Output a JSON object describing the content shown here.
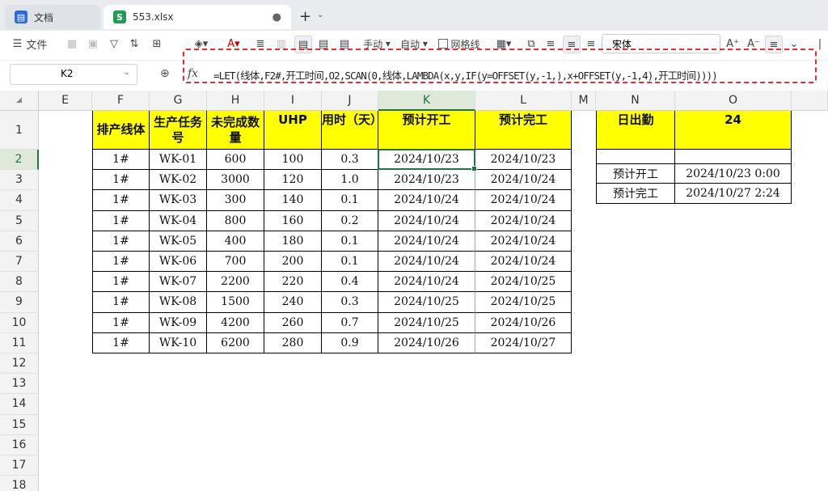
{
  "tabs": [
    {
      "label": "文档",
      "active": false,
      "icon": "doc-icon",
      "color": "#2f6bd8"
    },
    {
      "label": "553.xlsx",
      "active": true,
      "icon": "sheet-icon",
      "color": "#1f9d55"
    }
  ],
  "toolbar": {
    "file_label": "文件",
    "manual_label": "手动",
    "auto_label": "自动",
    "gridlines_label": "网格线",
    "font_name": "宋体"
  },
  "formula_bar": {
    "cell_ref": "K2",
    "formula": "=LET(线体,F2#,开工时间,O2,SCAN(0,线体,LAMBDA(x,y,IF(y=OFFSET(y,-1,),x+OFFSET(y,-1,4),开工时间))))"
  },
  "columns": [
    "E",
    "F",
    "G",
    "H",
    "I",
    "J",
    "K",
    "L",
    "M",
    "N",
    "O"
  ],
  "selected_column": "K",
  "rows": [
    "1",
    "2",
    "3",
    "4",
    "5",
    "6",
    "7",
    "8",
    "9",
    "10",
    "11",
    "12",
    "13",
    "14",
    "15",
    "16",
    "17",
    "18"
  ],
  "selected_row": "2",
  "table": {
    "headers": [
      "排产线体",
      "生产任务号",
      "未完成数量",
      "UHP",
      "用时（天）",
      "预计开工",
      "预计完工"
    ],
    "data": [
      [
        "1#",
        "WK-01",
        "600",
        "100",
        "0.3",
        "2024/10/23",
        "2024/10/23"
      ],
      [
        "1#",
        "WK-02",
        "3000",
        "120",
        "1.0",
        "2024/10/23",
        "2024/10/24"
      ],
      [
        "1#",
        "WK-03",
        "300",
        "140",
        "0.1",
        "2024/10/24",
        "2024/10/24"
      ],
      [
        "1#",
        "WK-04",
        "800",
        "160",
        "0.2",
        "2024/10/24",
        "2024/10/24"
      ],
      [
        "1#",
        "WK-05",
        "400",
        "180",
        "0.1",
        "2024/10/24",
        "2024/10/24"
      ],
      [
        "1#",
        "WK-06",
        "700",
        "200",
        "0.1",
        "2024/10/24",
        "2024/10/24"
      ],
      [
        "1#",
        "WK-07",
        "2200",
        "220",
        "0.4",
        "2024/10/24",
        "2024/10/25"
      ],
      [
        "1#",
        "WK-08",
        "1500",
        "240",
        "0.3",
        "2024/10/25",
        "2024/10/25"
      ],
      [
        "1#",
        "WK-09",
        "4200",
        "260",
        "0.7",
        "2024/10/25",
        "2024/10/26"
      ],
      [
        "1#",
        "WK-10",
        "6200",
        "280",
        "0.9",
        "2024/10/26",
        "2024/10/27"
      ]
    ]
  },
  "side": {
    "label1": "日出勤",
    "value1": "24",
    "label2": "预计开工",
    "value2": "2024/10/23 0:00",
    "label3": "预计完工",
    "value3": "2024/10/27 2:24"
  },
  "colors": {
    "header_fill": "#ffff00",
    "selection": "#217346",
    "annotation": "#e03030"
  }
}
